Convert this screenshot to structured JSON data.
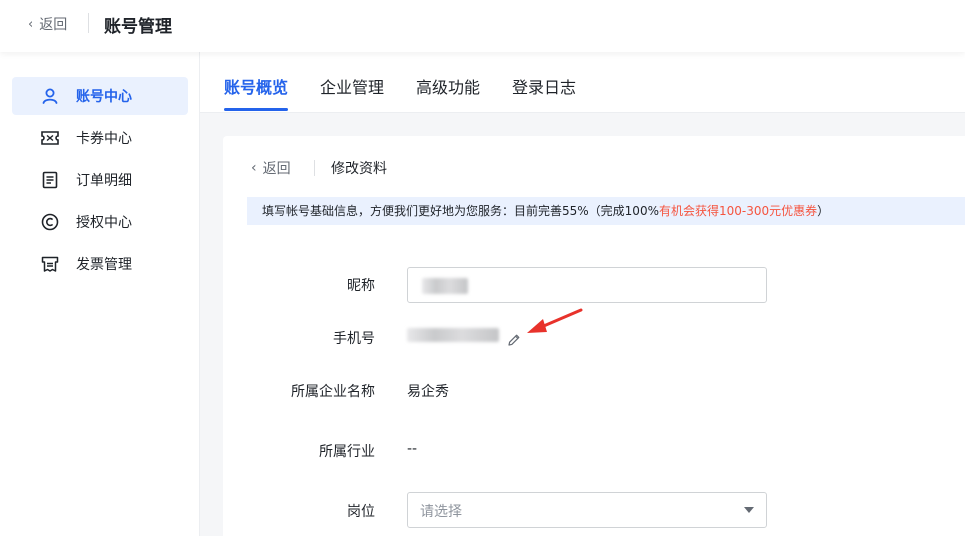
{
  "topbar": {
    "back_label": "返回",
    "title": "账号管理"
  },
  "sidebar": {
    "items": [
      {
        "label": "账号中心",
        "icon": "user-icon",
        "active": true
      },
      {
        "label": "卡券中心",
        "icon": "ticket-icon",
        "active": false
      },
      {
        "label": "订单明细",
        "icon": "order-list-icon",
        "active": false
      },
      {
        "label": "授权中心",
        "icon": "copyright-icon",
        "active": false
      },
      {
        "label": "发票管理",
        "icon": "invoice-icon",
        "active": false
      }
    ]
  },
  "tabs": [
    {
      "label": "账号概览",
      "active": true
    },
    {
      "label": "企业管理",
      "active": false
    },
    {
      "label": "高级功能",
      "active": false
    },
    {
      "label": "登录日志",
      "active": false
    }
  ],
  "edit_profile": {
    "back_label": "返回",
    "title": "修改资料",
    "notice_text": "填写帐号基础信息，方便我们更好地为您服务：目前完善55%（完成100%",
    "notice_highlight": "有机会获得100-300元优惠券",
    "notice_suffix": "）",
    "fields": {
      "nickname": {
        "label": "昵称",
        "value": ""
      },
      "phone": {
        "label": "手机号",
        "value": ""
      },
      "company": {
        "label": "所属企业名称",
        "value": "易企秀"
      },
      "industry": {
        "label": "所属行业",
        "value": "--"
      },
      "position": {
        "label": "岗位",
        "placeholder": "请选择"
      }
    }
  },
  "colors": {
    "accent": "#2463eb",
    "highlight_red": "#f5543f",
    "arrow_red": "#e8322b"
  }
}
